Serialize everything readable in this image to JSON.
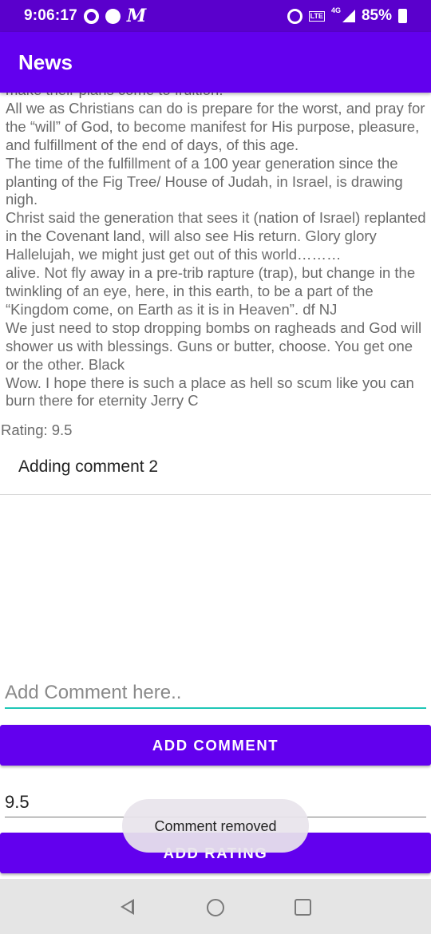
{
  "status_bar": {
    "time": "9:06:17",
    "battery": "85%",
    "network": "4G",
    "volte": "LTE",
    "icons": [
      "data-saver-icon",
      "circle-notification-icon",
      "m-app-icon",
      "alarm-icon",
      "volte-icon",
      "signal-icon",
      "battery-charging-icon"
    ]
  },
  "app_bar": {
    "title": "News"
  },
  "comments": {
    "text": "make their plans come to fruition.\nAll we as Christians can do is prepare for the worst, and pray for the “will” of God, to become manifest for His purpose, pleasure, and fulfillment of the end of days, of this age.\nThe time of the fulfillment of a 100 year generation since the planting of the Fig Tree/ House of Judah, in Israel, is drawing nigh.\nChrist said the generation that sees it (nation of Israel) replanted in the Covenant land, will also see His return. Glory glory Hallelujah, we might just get out of this world………\nalive. Not fly away in a pre-trib rapture (trap), but change in the twinkling of an eye, here, in this earth, to be a part of the “Kingdom come, on Earth as it is in Heaven”. df NJ\nWe just need to stop dropping bombs on ragheads and God will shower us with blessings. Guns or butter, choose. You get one or the other. Black\nWow. I hope there is such a place as hell so scum like you can burn there for eternity Jerry C"
  },
  "rating": {
    "label": "Rating: 9.5"
  },
  "comment_list": {
    "items": [
      "Adding comment 2"
    ]
  },
  "comment_field": {
    "placeholder": "Add Comment here..",
    "value": ""
  },
  "buttons": {
    "add_comment": "ADD COMMENT",
    "add_rating": "ADD RATING"
  },
  "rating_field": {
    "value": "9.5"
  },
  "toast": {
    "text": "Comment removed"
  },
  "colors": {
    "primary": "#6200ee",
    "primary_dark": "#5a00cc",
    "accent": "#1fc7b6"
  }
}
